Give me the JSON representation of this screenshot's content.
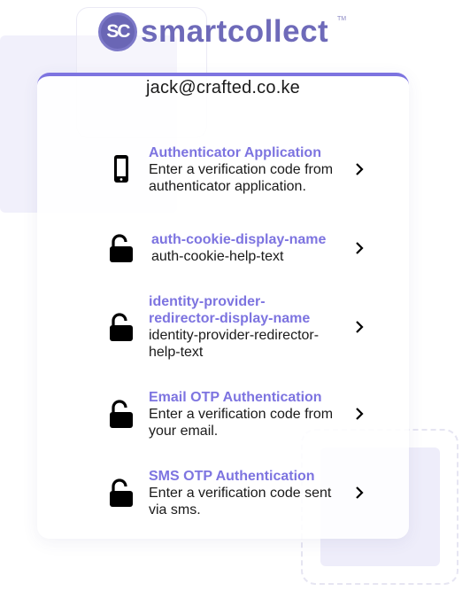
{
  "brand": {
    "logo_mark": "SC",
    "name": "smartcollect",
    "trademark": "TM"
  },
  "user": {
    "email": "jack@crafted.co.ke"
  },
  "options": [
    {
      "icon": "phone-icon",
      "title": "Authenticator Application",
      "help": "Enter a verification code from authenticator application."
    },
    {
      "icon": "unlock-icon",
      "title": "auth-cookie-display-name",
      "help": "auth-cookie-help-text"
    },
    {
      "icon": "unlock-icon",
      "title": "identity-provider-redirector-display-name",
      "help": "identity-provider-redirector-help-text"
    },
    {
      "icon": "unlock-icon",
      "title": "Email OTP Authentication",
      "help": "Enter a verification code from your email."
    },
    {
      "icon": "unlock-icon",
      "title": "SMS OTP Authentication",
      "help": "Enter a verification code sent via sms."
    }
  ],
  "colors": {
    "accent": "#7d74e0",
    "brand": "#6e6ab9",
    "text": "#1a1a1a"
  }
}
